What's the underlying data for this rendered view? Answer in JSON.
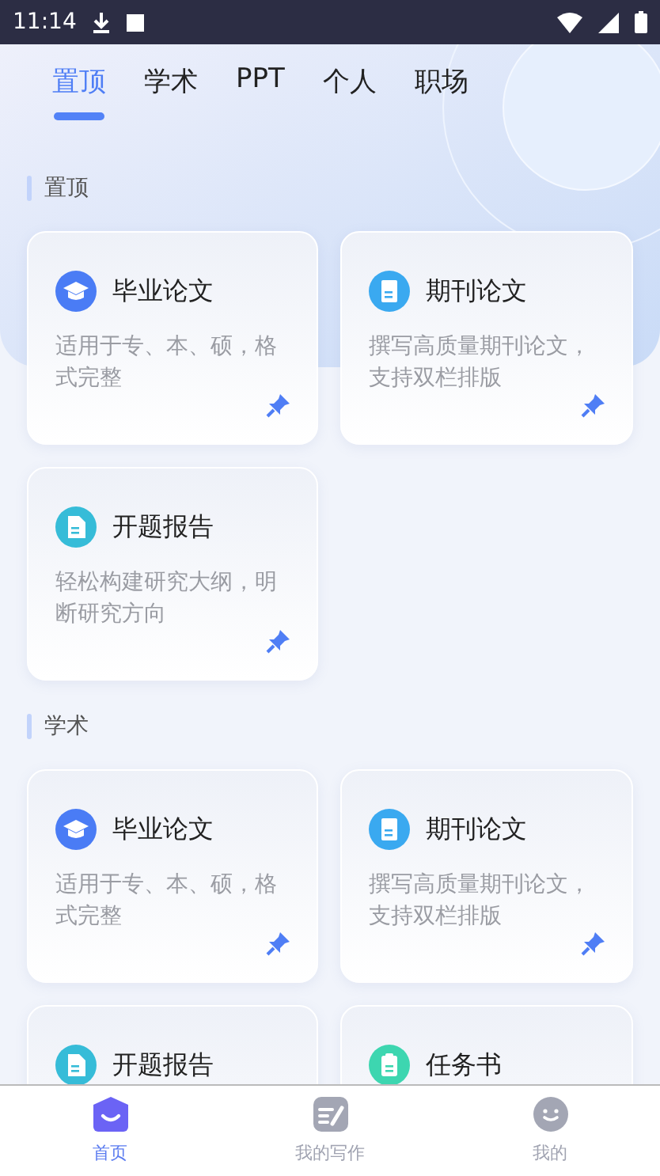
{
  "status_bar": {
    "time": "11:14"
  },
  "tabs": [
    {
      "label": "置顶",
      "selected": true
    },
    {
      "label": "学术",
      "selected": false
    },
    {
      "label": "PPT",
      "selected": false
    },
    {
      "label": "个人",
      "selected": false
    },
    {
      "label": "职场",
      "selected": false
    }
  ],
  "sections": [
    {
      "title": "置顶",
      "cards": [
        {
          "kind": "cap",
          "title": "毕业论文",
          "description": "适用于专、本、硕，格式完整",
          "pinned": true
        },
        {
          "kind": "journal",
          "title": "期刊论文",
          "description": "撰写高质量期刊论文，支持双栏排版",
          "pinned": true
        },
        {
          "kind": "report",
          "title": "开题报告",
          "description": "轻松构建研究大纲，明断研究方向",
          "pinned": true
        }
      ]
    },
    {
      "title": "学术",
      "cards": [
        {
          "kind": "cap",
          "title": "毕业论文",
          "description": "适用于专、本、硕，格式完整",
          "pinned": true
        },
        {
          "kind": "journal",
          "title": "期刊论文",
          "description": "撰写高质量期刊论文，支持双栏排版",
          "pinned": true
        },
        {
          "kind": "report",
          "title": "开题报告"
        },
        {
          "kind": "task",
          "title": "任务书"
        }
      ]
    }
  ],
  "bottom_nav": [
    {
      "kind": "home",
      "label": "首页",
      "selected": true
    },
    {
      "kind": "write",
      "label": "我的写作",
      "selected": false
    },
    {
      "kind": "me",
      "label": "我的",
      "selected": false
    }
  ]
}
